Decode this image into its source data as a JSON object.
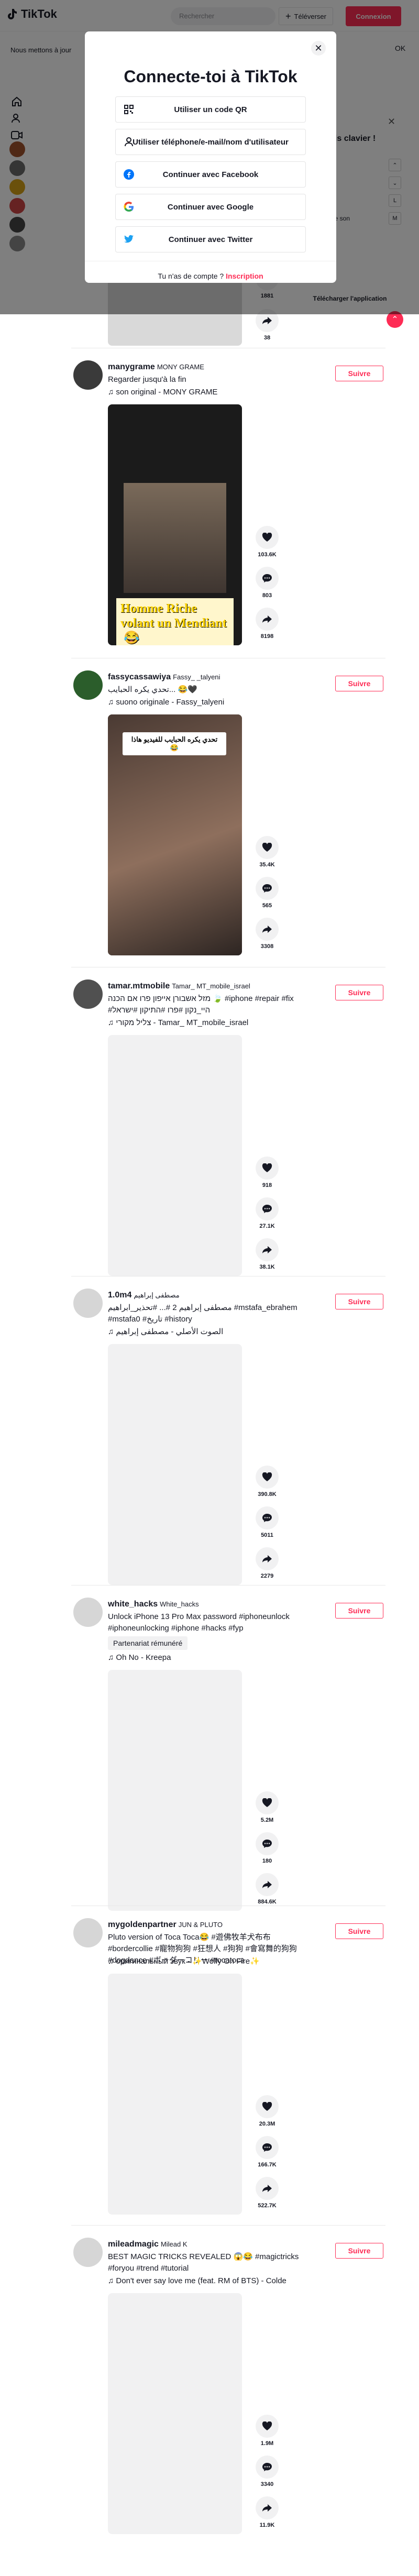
{
  "header": {
    "logo_text": "TikTok",
    "search_placeholder": "Rechercher",
    "upload_label": "Téléverser",
    "login_label": "Connexion"
  },
  "cookie_notice": {
    "text": "Nous mettons à jour",
    "ok_label": "OK"
  },
  "keyboard_panel": {
    "title": "cis clavier !",
    "rows": [
      {
        "label": "",
        "key": "⌃"
      },
      {
        "label": "",
        "key": "⌄"
      },
      {
        "label": "",
        "key": "L"
      },
      {
        "label": "er le son",
        "key": "M"
      }
    ]
  },
  "download_app": "Télécharger l'application",
  "modal": {
    "title": "Connecte-toi à TikTok",
    "options": [
      {
        "label": "Utiliser un code QR",
        "icon": "qr-code-icon"
      },
      {
        "label": "Utiliser téléphone/e-mail/nom d'utilisateur",
        "icon": "user-icon"
      },
      {
        "label": "Continuer avec Facebook",
        "icon": "facebook-icon"
      },
      {
        "label": "Continuer avec Google",
        "icon": "google-icon"
      },
      {
        "label": "Continuer avec Twitter",
        "icon": "twitter-icon"
      }
    ],
    "footer_text": "Tu n'as de compte ?",
    "footer_link": "Inscription"
  },
  "partial_post": {
    "counts": [
      "1881",
      "38"
    ]
  },
  "posts": [
    {
      "username": "manygrame",
      "nickname": "MONY GRAME",
      "description": "Regarder jusqu'à la fin",
      "music": "son original - MONY GRAME",
      "follow_label": "Suivre",
      "video_caption": "Homme Riche volant un Mendiant",
      "video_caption_emoji": "😂",
      "likes": "103.6K",
      "comments": "803",
      "shares": "8198"
    },
    {
      "username": "fassycassawiya",
      "nickname": "Fassy_ _talyeni",
      "description": "تحدي يكره الحبايب... 😂🖤",
      "music": "suono originale - Fassy_talyeni",
      "follow_label": "Suivre",
      "video_topcap": "تحدي يكره الحبايب للفيديو هاذا 😂",
      "likes": "35.4K",
      "comments": "565",
      "shares": "3308"
    },
    {
      "username": "tamar.mtmobile",
      "nickname": "Tamar_ MT_mobile_israel",
      "description": "מזל אשבורן אייפון פרו אם הכנה 🍃 #iphone #repair #fix #היי_נקון #פרו #התיקון #ישראל",
      "music": "צליל מקורי - Tamar_ MT_mobile_israel",
      "follow_label": "Suivre",
      "likes": "918",
      "comments": "27.1K",
      "shares": "38.1K"
    },
    {
      "username": "1.0m4",
      "nickname": "مصطفى إبراهيم",
      "description": "مصطفى إبراهيم 2 #... #تحذير_ابراهيم #mstafa_ebrahem #mstafa0 #تاريخ #history",
      "music": "الصوت الأصلي - مصطفى إبراهيم",
      "follow_label": "Suivre",
      "likes": "390.8K",
      "comments": "5011",
      "shares": "2279"
    },
    {
      "username": "white_hacks",
      "nickname": "White_hacks",
      "description": "Unlock iPhone 13 Pro Max password #iphoneunlock #iphoneunlocking #iphone #hacks #fyp",
      "tag_chip": "Partenariat rémunéré",
      "music": "Oh No - Kreepa",
      "follow_label": "Suivre",
      "likes": "5.2M",
      "comments": "180",
      "shares": "884.6K"
    },
    {
      "username": "mygoldenpartner",
      "nickname": "JUN & PLUTO",
      "description": "Pluto version of Toca Toca😂 #遊佛牧羊犬布布 #bordercollie #寵物狗狗 #狂想人 #狗狗 #會寫舞的狗狗 #dogdance #ボーダーコリー #tocatoca",
      "music": "оригинальный звук - ✨Wolfy On Fire✨",
      "follow_label": "Suivre",
      "likes": "20.3M",
      "comments": "166.7K",
      "shares": "522.7K"
    },
    {
      "username": "mileadmagic",
      "nickname": "Milead K",
      "description": "BEST MAGIC TRICKS REVEALED 😱😂 #magictricks #foryou #trend #tutorial",
      "music": "Don't ever say love me (feat. RM of BTS) - Colde",
      "follow_label": "Suivre",
      "likes": "1.9M",
      "comments": "3340",
      "shares": "11.9K"
    }
  ],
  "colors": {
    "brand": "#fe2c55",
    "text": "#161823",
    "muted_bg": "#f1f1f2"
  }
}
